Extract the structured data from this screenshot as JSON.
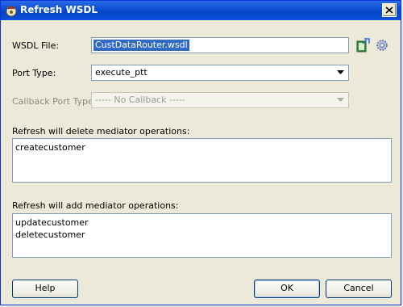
{
  "window": {
    "title": "Refresh WSDL"
  },
  "form": {
    "wsdl_file_label": "WSDL File:",
    "wsdl_file_value": "CustDataRouter.wsdl",
    "port_type_label": "Port Type:",
    "port_type_value": "execute_ptt",
    "callback_port_type_label": "Callback Port Type:",
    "callback_port_type_value": "----- No Callback -----"
  },
  "delete_ops": {
    "label": "Refresh will delete mediator operations:",
    "items": [
      "createcustomer"
    ]
  },
  "add_ops": {
    "label": "Refresh will add mediator operations:",
    "items": [
      "updatecustomer",
      "deletecustomer"
    ]
  },
  "buttons": {
    "help": "Help",
    "ok": "OK",
    "cancel": "Cancel"
  },
  "icons": {
    "browse": "wsdl-browse-icon",
    "settings": "gear-icon",
    "close": "close-icon",
    "app": "app-icon"
  }
}
